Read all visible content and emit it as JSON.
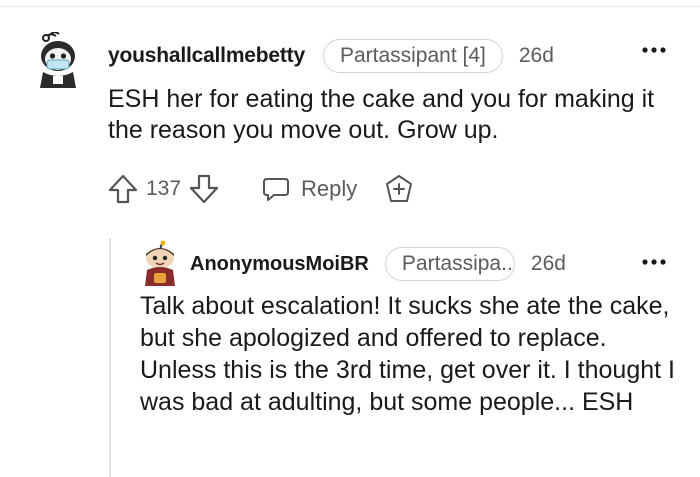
{
  "comment": {
    "username": "youshallcallmebetty",
    "flair": "Partassipant [4]",
    "time": "26d",
    "body": "ESH her for eating the cake and you for making it the reason you move out. Grow up.",
    "vote_count": "137",
    "reply_label": "Reply",
    "avatar_icon": "snoo-avatar-masked-icon",
    "more_icon": "more-options-icon"
  },
  "reply": {
    "username": "AnonymousMoiBR",
    "flair": "Partassipa...",
    "time": "26d",
    "body": "Talk about escalation! It sucks she ate the cake, but she apologized and offered to replace. Unless this is the 3rd time, get over it. I thought I was bad at adulting, but some people... ESH",
    "avatar_icon": "snoo-avatar-icon",
    "more_icon": "more-options-icon"
  },
  "colors": {
    "text": "#1a1a1b",
    "meta": "#5c5c5c",
    "border": "#d3d3d3",
    "thread_line": "#e3e3e3"
  }
}
